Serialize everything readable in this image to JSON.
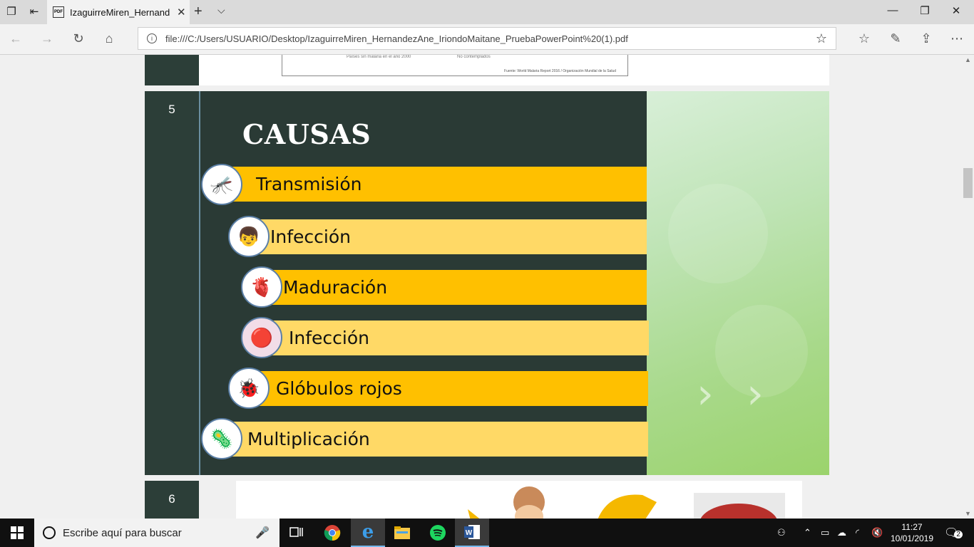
{
  "browser": {
    "tab_title": "IzaguirreMiren_Hernandez",
    "tab_icon_text": "PDF",
    "url": "file:///C:/Users/USUARIO/Desktop/IzaguirreMiren_HernandezAne_IriondoMaitane_PruebaPowerPoint%20(1).pdf"
  },
  "prev_slide": {
    "legend1": "Países sin malaria en el año 2000",
    "legend2": "No contemplados",
    "source": "Fuente: World Malaria Report 2016 / Organización Mundial de la Salud"
  },
  "slide5": {
    "number": "5",
    "title": "CAUSAS",
    "items": [
      {
        "label": "Transmisión",
        "icon": "mosquito-icon"
      },
      {
        "label": "Infección",
        "icon": "child-bitten-icon"
      },
      {
        "label": "Maduración",
        "icon": "liver-icon"
      },
      {
        "label": "Infección",
        "icon": "red-cells-icon"
      },
      {
        "label": "Glóbulos rojos",
        "icon": "red-cell-character-icon"
      },
      {
        "label": "Multiplicación",
        "icon": "microbes-icon"
      }
    ]
  },
  "slide6": {
    "number": "6"
  },
  "taskbar": {
    "search_placeholder": "Escribe aquí para buscar",
    "time": "11:27",
    "date": "10/01/2019",
    "notifications": "2"
  }
}
